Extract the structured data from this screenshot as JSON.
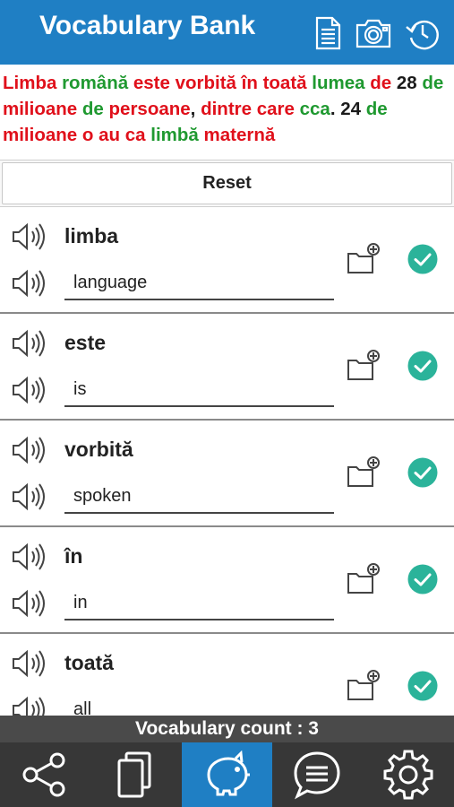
{
  "header": {
    "title": "Vocabulary Bank",
    "icons": [
      "document-icon",
      "camera-icon",
      "history-icon"
    ],
    "background": "#1f7fc4"
  },
  "sentence": {
    "words": [
      {
        "text": "Limba",
        "color": "red"
      },
      {
        "text": " ",
        "color": "black"
      },
      {
        "text": "română",
        "color": "green"
      },
      {
        "text": " ",
        "color": "black"
      },
      {
        "text": "este",
        "color": "red"
      },
      {
        "text": " ",
        "color": "black"
      },
      {
        "text": "vorbită",
        "color": "red"
      },
      {
        "text": " ",
        "color": "black"
      },
      {
        "text": "în",
        "color": "red"
      },
      {
        "text": " ",
        "color": "black"
      },
      {
        "text": "toată",
        "color": "red"
      },
      {
        "text": " ",
        "color": "black"
      },
      {
        "text": "lumea",
        "color": "green"
      },
      {
        "text": " ",
        "color": "black"
      },
      {
        "text": "de",
        "color": "red"
      },
      {
        "text": " ",
        "color": "black"
      },
      {
        "text": "28",
        "color": "black"
      },
      {
        "text": " ",
        "color": "black"
      },
      {
        "text": "de",
        "color": "green"
      },
      {
        "text": " ",
        "color": "black"
      },
      {
        "text": "milioane",
        "color": "red"
      },
      {
        "text": " ",
        "color": "black"
      },
      {
        "text": "de",
        "color": "green"
      },
      {
        "text": " ",
        "color": "black"
      },
      {
        "text": "persoane",
        "color": "red"
      },
      {
        "text": ", ",
        "color": "black"
      },
      {
        "text": "dintre",
        "color": "red"
      },
      {
        "text": " ",
        "color": "black"
      },
      {
        "text": "care",
        "color": "red"
      },
      {
        "text": " ",
        "color": "black"
      },
      {
        "text": "cca",
        "color": "green"
      },
      {
        "text": ". 24 ",
        "color": "black"
      },
      {
        "text": "de",
        "color": "green"
      },
      {
        "text": " ",
        "color": "black"
      },
      {
        "text": "milioane",
        "color": "red"
      },
      {
        "text": " ",
        "color": "black"
      },
      {
        "text": "o",
        "color": "red"
      },
      {
        "text": " ",
        "color": "black"
      },
      {
        "text": "au",
        "color": "red"
      },
      {
        "text": " ",
        "color": "black"
      },
      {
        "text": "ca",
        "color": "red"
      },
      {
        "text": " ",
        "color": "black"
      },
      {
        "text": "limbă",
        "color": "green"
      },
      {
        "text": " ",
        "color": "black"
      },
      {
        "text": "maternă",
        "color": "red"
      }
    ],
    "colors": {
      "red": "#e0101b",
      "green": "#1f9930",
      "black": "#1a1a1a"
    }
  },
  "reset_label": "Reset",
  "vocab": [
    {
      "word": "limba",
      "translation": "language"
    },
    {
      "word": "este",
      "translation": "is"
    },
    {
      "word": "vorbită",
      "translation": "spoken"
    },
    {
      "word": "în",
      "translation": "in"
    },
    {
      "word": "toată",
      "translation": "all"
    }
  ],
  "row_icons": {
    "speaker": "speaker-icon",
    "folder": "folder-add-icon",
    "check": "check-circle-icon",
    "check_color": "#2bb39a"
  },
  "footer": {
    "count_text": "Vocabulary count : 3",
    "tabs": [
      {
        "name": "share-icon",
        "active": false
      },
      {
        "name": "cards-icon",
        "active": false
      },
      {
        "name": "piggy-bank-icon",
        "active": true
      },
      {
        "name": "chat-icon",
        "active": false
      },
      {
        "name": "settings-icon",
        "active": false
      }
    ]
  }
}
